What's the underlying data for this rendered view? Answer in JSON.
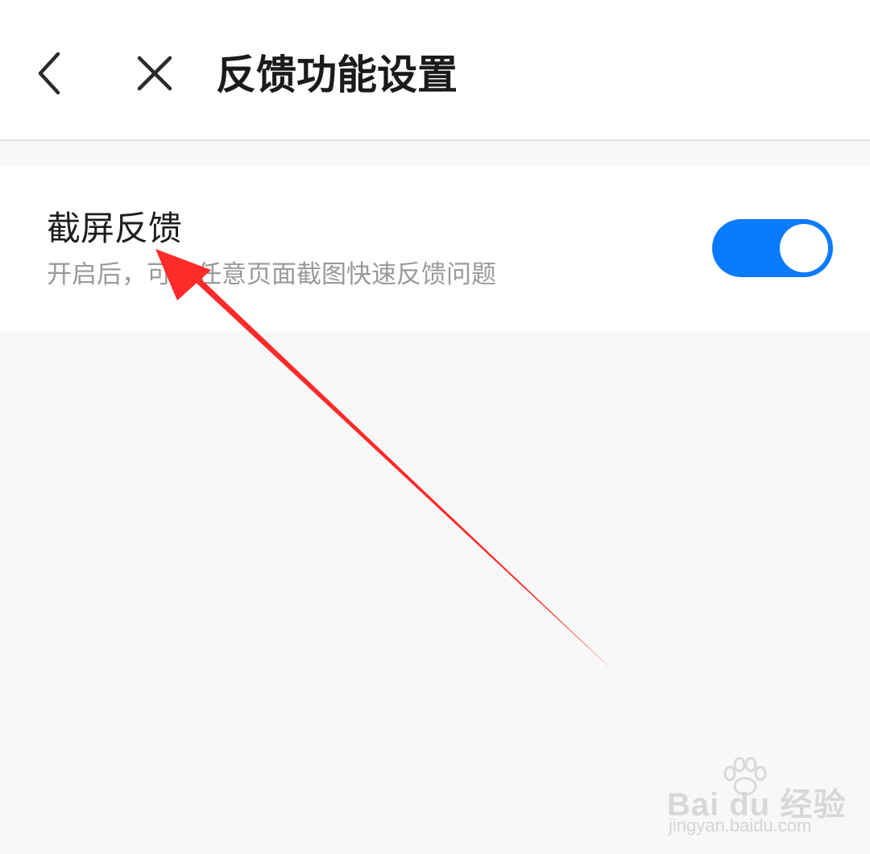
{
  "header": {
    "title": "反馈功能设置",
    "back_icon": "chevron-left-icon",
    "close_icon": "close-icon"
  },
  "setting": {
    "label": "截屏反馈",
    "description": "开启后，可在任意页面截图快速反馈问题",
    "toggle_on": true,
    "toggle_color": "#0a7aff"
  },
  "annotation": {
    "arrow_color": "#ff2a2a"
  },
  "watermark": {
    "logo_text": "Bai du 经验",
    "url": "jingyan.baidu.com"
  }
}
